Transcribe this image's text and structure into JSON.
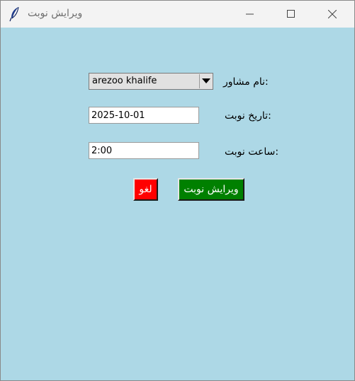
{
  "window": {
    "title": "ویرایش نوبت",
    "app_icon": "feather-icon",
    "minimize_icon": "minimize-icon",
    "maximize_icon": "maximize-icon",
    "close_icon": "close-icon"
  },
  "form": {
    "advisor_label": ":نام مشاور",
    "advisor_value": "arezoo khalife",
    "date_label": ":تاریخ نوبت",
    "date_value": "2025-10-01",
    "time_label": ":ساعت نوبت",
    "time_value": "2:00"
  },
  "buttons": {
    "cancel_label": "لغو",
    "edit_label": "ویرایش نوبت"
  },
  "colors": {
    "background": "#add8e6",
    "cancel_button": "#ff0000",
    "edit_button": "#008000"
  }
}
